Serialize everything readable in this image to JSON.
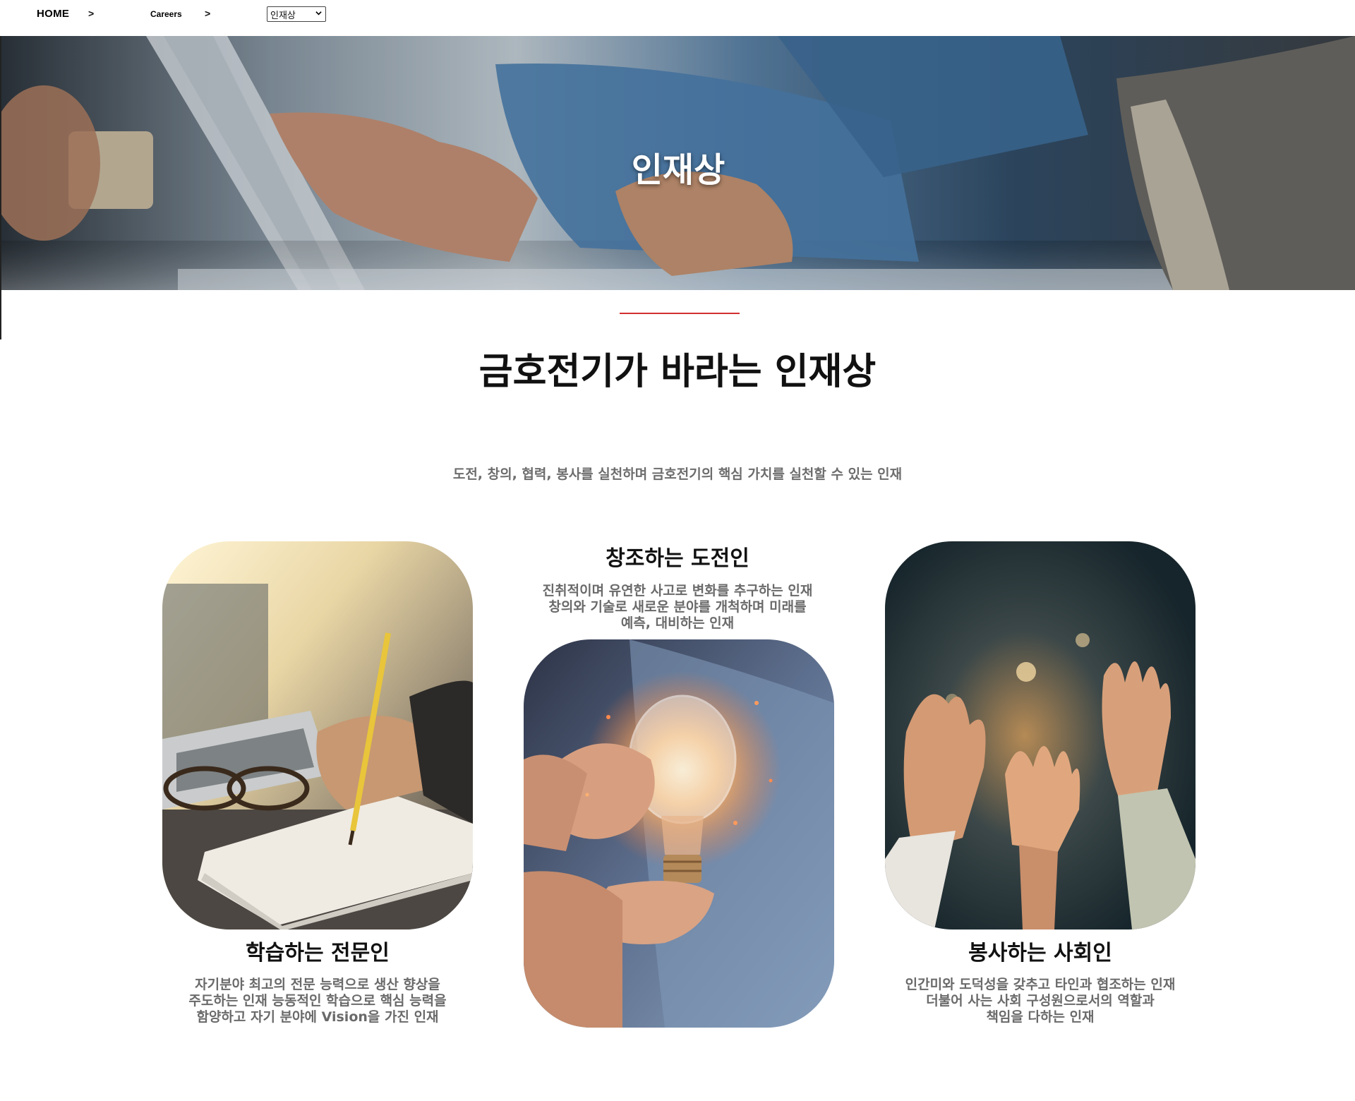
{
  "breadcrumb": {
    "home": "HOME",
    "sep1": ">",
    "careers": "Careers",
    "sep2": ">",
    "select_value": "인재상"
  },
  "hero": {
    "title": "인재상"
  },
  "main": {
    "title": "금호전기가 바라는 인재상",
    "subtitle": "도전, 창의, 협력, 봉사를 실천하며 금호전기의 핵심 가치를 실천할 수 있는 인재"
  },
  "cards": [
    {
      "title": "학습하는 전문인",
      "desc": [
        "자기분야 최고의 전문 능력으로 생산 향상을",
        "주도하는 인재 능동적인 학습으로 핵심 능력을",
        "함양하고 자기 분야에 Vision을 가진 인재"
      ]
    },
    {
      "title": "창조하는 도전인",
      "desc": [
        "진취적이며 유연한 사고로 변화를 추구하는 인재",
        "창의와 기술로 새로운 분야를 개척하며 미래를",
        "예측, 대비하는 인재"
      ]
    },
    {
      "title": "봉사하는 사회인",
      "desc": [
        "인간미와 도덕성을 갖추고 타인과 협조하는 인재",
        "더불어 사는 사회 구성원으로서의 역할과",
        "책임을 다하는 인재"
      ]
    }
  ],
  "colors": {
    "accent_line": "#d22f2f",
    "desc_text": "#6a6a6a"
  },
  "icons": {
    "select": "chevron-down-icon"
  }
}
